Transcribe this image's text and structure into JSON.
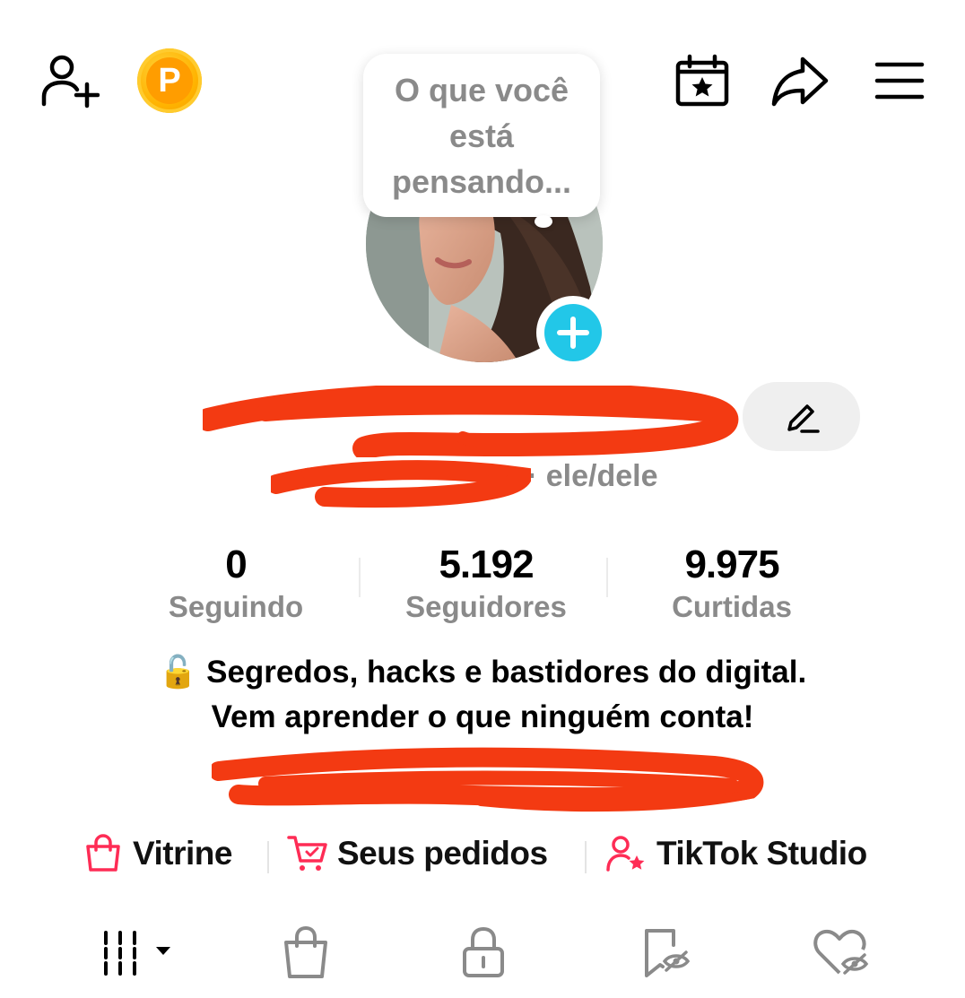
{
  "header": {
    "add_friend_icon": "person-plus-icon",
    "coin_letter": "P",
    "calendar_icon": "calendar-star-icon",
    "share_icon": "share-arrow-icon",
    "menu_icon": "hamburger-menu-icon"
  },
  "bubble": {
    "text": "O que você está pensando..."
  },
  "profile": {
    "pronouns": "· ele/dele"
  },
  "stats": [
    {
      "value": "0",
      "label": "Seguindo"
    },
    {
      "value": "5.192",
      "label": "Seguidores"
    },
    {
      "value": "9.975",
      "label": "Curtidas"
    }
  ],
  "bio": {
    "line1": "🔓 Segredos, hacks e bastidores do digital.",
    "line2": "Vem aprender o que ninguém conta!"
  },
  "links": [
    {
      "label": "Vitrine",
      "icon": "shopping-bag-icon"
    },
    {
      "label": "Seus pedidos",
      "icon": "cart-check-icon"
    },
    {
      "label": "TikTok Studio",
      "icon": "person-star-icon"
    }
  ],
  "tabs": [
    {
      "icon": "grid-icon"
    },
    {
      "icon": "shop-bag-icon"
    },
    {
      "icon": "lock-icon"
    },
    {
      "icon": "bookmark-hidden-icon"
    },
    {
      "icon": "heart-hidden-icon"
    }
  ],
  "colors": {
    "accent_cyan": "#22c7e8",
    "accent_pink": "#fe2c55",
    "coin_gold": "#ffb300",
    "label_gray": "#8a8a8a",
    "redaction": "#f33a12"
  }
}
